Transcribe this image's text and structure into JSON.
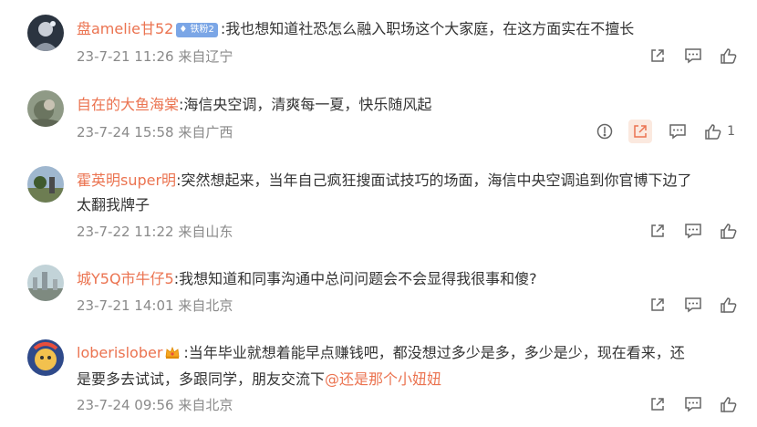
{
  "comments": [
    {
      "username": "盘amelie甘52",
      "badge": "铁粉2",
      "text": ":我也想知道社恐怎么融入职场这个大家庭，在这方面实在不擅长",
      "date": "23-7-21 11:26",
      "location": "来自辽宁",
      "likes": ""
    },
    {
      "username": "自在的大鱼海棠",
      "text": ":海信央空调，清爽每一夏，快乐随风起",
      "date": "23-7-24 15:58",
      "location": "来自广西",
      "likes": "1"
    },
    {
      "username": "霍英明super明",
      "text": ":突然想起来，当年自己疯狂搜面试技巧的场面，海信中央空调追到你官博下边了",
      "text2": "太翻我牌子",
      "date": "23-7-22 11:22",
      "location": "来自山东",
      "likes": ""
    },
    {
      "username": "城Y5Q市牛仔5",
      "text": ":我想知道和同事沟通中总问问题会不会显得我很事和傻?",
      "date": "23-7-21 14:01",
      "location": "来自北京",
      "likes": ""
    },
    {
      "username": "loberislober",
      "text": ":当年毕业就想着能早点赚钱吧，都没想过多少是多，多少是少，现在看来，还",
      "text2": "是要多去试试，多跟同学，朋友交流下",
      "mention": "@还是那个小妞妞",
      "date": "23-7-24 09:56",
      "location": "来自北京",
      "likes": ""
    }
  ],
  "colors": {
    "username": "#eb7350",
    "meta": "#8a8a8a",
    "badge": "#7ba6e6"
  },
  "icons": [
    "report-icon",
    "share-icon",
    "comment-icon",
    "like-icon"
  ]
}
